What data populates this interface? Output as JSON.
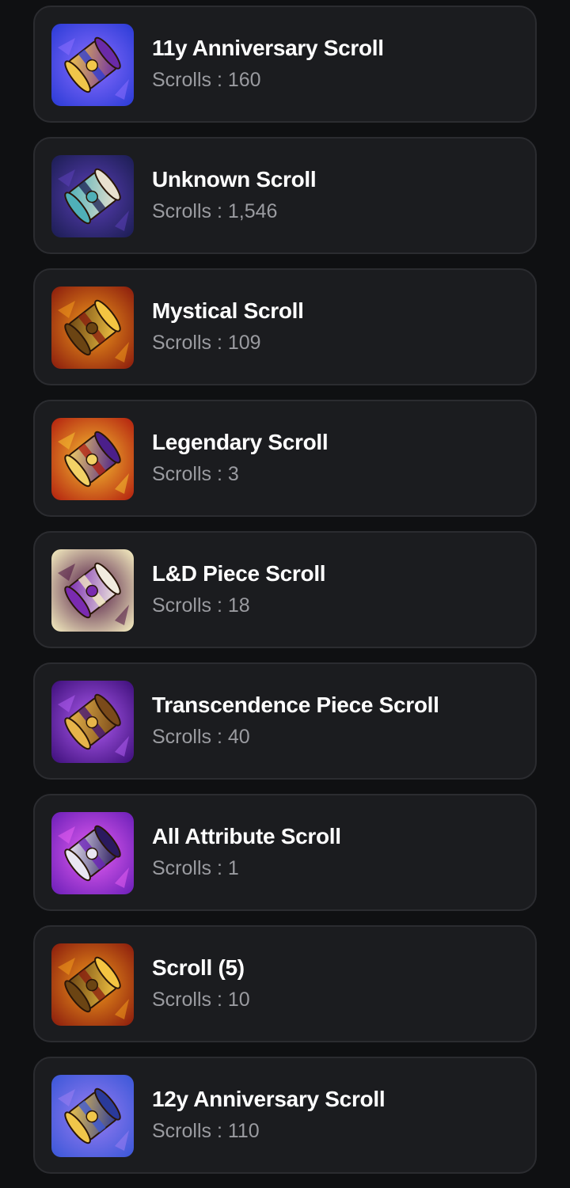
{
  "scrolls": [
    {
      "name": "11y Anniversary Scroll",
      "count_label": "Scrolls : 160",
      "icon": "anniversary-scroll-11y-icon",
      "colors": [
        "#2a3bd6",
        "#8b6dff",
        "#6a2aa8",
        "#f0c64a"
      ]
    },
    {
      "name": "Unknown Scroll",
      "count_label": "Scrolls : 1,546",
      "icon": "unknown-scroll-icon",
      "colors": [
        "#1b1d52",
        "#5b3fb8",
        "#e9e1cf",
        "#4fb0b8"
      ]
    },
    {
      "name": "Mystical Scroll",
      "count_label": "Scrolls : 109",
      "icon": "mystical-scroll-icon",
      "colors": [
        "#8a1b0d",
        "#f29a1c",
        "#f4c542",
        "#6b4413"
      ]
    },
    {
      "name": "Legendary Scroll",
      "count_label": "Scrolls : 3",
      "icon": "legendary-scroll-icon",
      "colors": [
        "#b3200f",
        "#f7c232",
        "#4b1f8a",
        "#f2d266"
      ]
    },
    {
      "name": "L&D Piece Scroll",
      "count_label": "Scrolls : 18",
      "icon": "light-dark-piece-scroll-icon",
      "colors": [
        "#f5eec0",
        "#4a1140",
        "#f1ecdf",
        "#7a2bb0"
      ]
    },
    {
      "name": "Transcendence Piece Scroll",
      "count_label": "Scrolls : 40",
      "icon": "transcendence-piece-scroll-icon",
      "colors": [
        "#3d0f7a",
        "#b05cf2",
        "#7a4a1a",
        "#e7b44a"
      ]
    },
    {
      "name": "All Attribute Scroll",
      "count_label": "Scrolls : 1",
      "icon": "all-attribute-scroll-icon",
      "colors": [
        "#6b1fb8",
        "#e65ef2",
        "#2a1a5e",
        "#e9e6f2"
      ]
    },
    {
      "name": "Scroll (5)",
      "count_label": "Scrolls : 10",
      "icon": "scroll-5-icon",
      "colors": [
        "#8a1b0d",
        "#f29a1c",
        "#f4c542",
        "#6b4413"
      ]
    },
    {
      "name": "12y Anniversary Scroll",
      "count_label": "Scrolls : 110",
      "icon": "anniversary-scroll-12y-icon",
      "colors": [
        "#3a57d8",
        "#9a7df2",
        "#2a3a9a",
        "#f0c64a"
      ]
    }
  ]
}
